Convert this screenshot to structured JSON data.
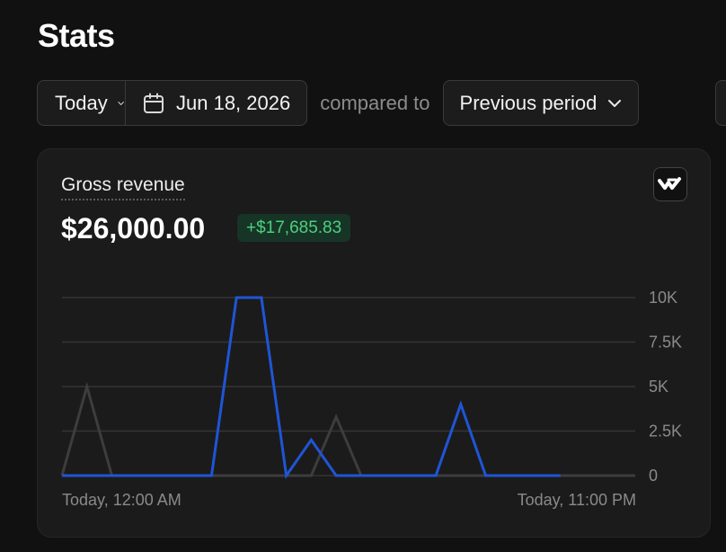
{
  "page": {
    "title": "Stats"
  },
  "filters": {
    "range_label": "Today",
    "date_label": "Jun 18, 2026",
    "compared_text": "compared to",
    "comparison_label": "Previous period"
  },
  "card": {
    "metric_label": "Gross revenue",
    "metric_value": "$26,000.00",
    "delta_badge": "+$17,685.83"
  },
  "colors": {
    "current_series": "#1f55d6",
    "previous_series": "#3d3d3d",
    "gridline": "#343434",
    "delta_positive": "#4bd17e"
  },
  "icons": {
    "range_chevron": "chevron-down-icon",
    "calendar": "calendar-icon",
    "comparison_chevron": "chevron-down-icon",
    "chart_toggle": "chart-logo-icon"
  },
  "chart_data": {
    "type": "line",
    "x": [
      0,
      1,
      2,
      3,
      4,
      5,
      6,
      7,
      8,
      9,
      10,
      11,
      12,
      13,
      14,
      15,
      16,
      17,
      18,
      19,
      20,
      21,
      22,
      23
    ],
    "x_tick_labels": [
      "Today, 12:00 AM",
      "Today, 11:00 PM"
    ],
    "y_tick_labels": [
      "10K",
      "7.5K",
      "5K",
      "2.5K",
      "0"
    ],
    "y_ticks": [
      10000,
      7500,
      5000,
      2500,
      0
    ],
    "ylim": [
      0,
      10000
    ],
    "grid": true,
    "series": [
      {
        "role": "previous",
        "values": [
          0,
          5000,
          0,
          0,
          0,
          0,
          0,
          0,
          0,
          0,
          0,
          3300,
          0,
          0,
          0,
          0,
          0,
          0,
          0,
          0,
          0,
          0,
          0,
          0
        ]
      },
      {
        "role": "current",
        "values": [
          0,
          0,
          0,
          0,
          0,
          0,
          0,
          10000,
          10000,
          0,
          2000,
          0,
          0,
          0,
          0,
          0,
          4000,
          0,
          0,
          0,
          0
        ]
      }
    ]
  }
}
